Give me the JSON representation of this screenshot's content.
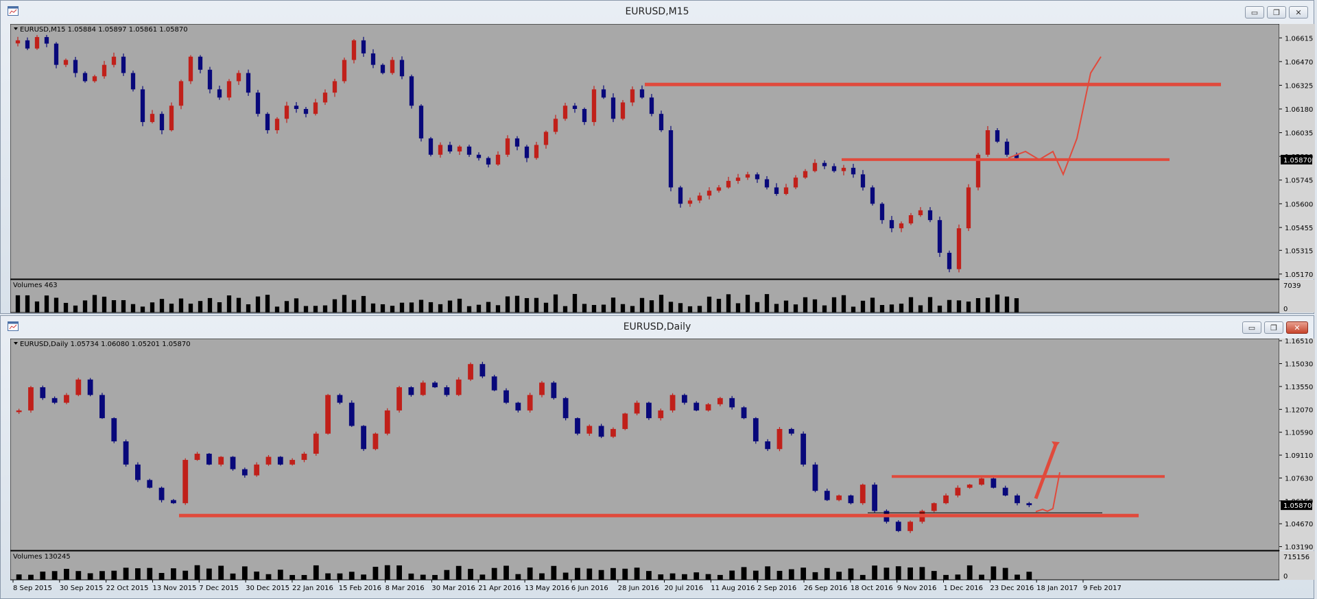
{
  "windows": [
    {
      "title": "EURUSD,M15",
      "info": "EURUSD,M15  1.05884 1.05897 1.05861 1.05870",
      "volume_label": "Volumes 463",
      "price_marker": "1.05870",
      "volume_scale": [
        "7039",
        "0"
      ],
      "buttons": [
        "minimize",
        "maximize",
        "close"
      ]
    },
    {
      "title": "EURUSD,Daily",
      "info": "EURUSD,Daily  1.05734 1.06080 1.05201 1.05870",
      "volume_label": "Volumes 130245",
      "price_marker": "1.05870",
      "volume_scale": [
        "715156",
        "0"
      ],
      "buttons": [
        "minimize",
        "maximize",
        "close"
      ]
    }
  ],
  "chart_data": [
    {
      "type": "candlestick",
      "symbol": "EURUSD",
      "timeframe": "M15",
      "y_ticks": [
        "1.06615",
        "1.06470",
        "1.06325",
        "1.06180",
        "1.06035",
        "1.05890",
        "1.05745",
        "1.05600",
        "1.05455",
        "1.05315",
        "1.05170"
      ],
      "ylim": [
        1.0514,
        1.067
      ],
      "last_price": 1.0587,
      "series": [
        {
          "name": "close",
          "values": [
            1.066,
            1.0655,
            1.0662,
            1.0658,
            1.0645,
            1.0648,
            1.064,
            1.0635,
            1.0638,
            1.0645,
            1.065,
            1.064,
            1.063,
            1.061,
            1.0615,
            1.0605,
            1.062,
            1.0635,
            1.065,
            1.0642,
            1.063,
            1.0625,
            1.0635,
            1.064,
            1.0628,
            1.0615,
            1.0605,
            1.0612,
            1.062,
            1.0618,
            1.0615,
            1.0622,
            1.0628,
            1.0635,
            1.0648,
            1.066,
            1.0652,
            1.0645,
            1.064,
            1.0648,
            1.0638,
            1.062,
            1.06,
            1.059,
            1.0596,
            1.0592,
            1.0595,
            1.059,
            1.0588,
            1.0584,
            1.059,
            1.06,
            1.0595,
            1.0588,
            1.0596,
            1.0604,
            1.0612,
            1.062,
            1.0618,
            1.061,
            1.063,
            1.0625,
            1.0612,
            1.0622,
            1.063,
            1.0625,
            1.0615,
            1.0605,
            1.057,
            1.056,
            1.0562,
            1.0565,
            1.0568,
            1.057,
            1.0574,
            1.0576,
            1.0578,
            1.0575,
            1.057,
            1.0566,
            1.057,
            1.0576,
            1.058,
            1.0585,
            1.0583,
            1.058,
            1.0582,
            1.0578,
            1.057,
            1.056,
            1.055,
            1.0545,
            1.0548,
            1.0553,
            1.0556,
            1.055,
            1.053,
            1.052,
            1.0545,
            1.057,
            1.059,
            1.0605,
            1.0598,
            1.059,
            1.0588
          ]
        }
      ],
      "annotations": [
        "horizontal line 1.0633",
        "horizontal line 1.0587",
        "projected path"
      ],
      "volume_panel": {
        "label": "Volumes 463",
        "max": 7039
      }
    },
    {
      "type": "candlestick",
      "symbol": "EURUSD",
      "timeframe": "Daily",
      "y_ticks": [
        "1.16510",
        "1.15030",
        "1.13550",
        "1.12070",
        "1.10590",
        "1.09110",
        "1.07630",
        "1.06150",
        "1.04670",
        "1.03190"
      ],
      "ylim": [
        1.0295,
        1.1665
      ],
      "last_price": 1.0587,
      "x_ticks": [
        "8 Sep 2015",
        "30 Sep 2015",
        "22 Oct 2015",
        "13 Nov 2015",
        "7 Dec 2015",
        "30 Dec 2015",
        "22 Jan 2016",
        "15 Feb 2016",
        "8 Mar 2016",
        "30 Mar 2016",
        "21 Apr 2016",
        "13 May 2016",
        "6 Jun 2016",
        "28 Jun 2016",
        "20 Jul 2016",
        "11 Aug 2016",
        "2 Sep 2016",
        "26 Sep 2016",
        "18 Oct 2016",
        "9 Nov 2016",
        "1 Dec 2016",
        "23 Dec 2016",
        "18 Jan 2017",
        "9 Feb 2017"
      ],
      "series": [
        {
          "name": "close",
          "values": [
            1.12,
            1.135,
            1.128,
            1.125,
            1.13,
            1.14,
            1.13,
            1.115,
            1.1,
            1.085,
            1.075,
            1.07,
            1.062,
            1.06,
            1.088,
            1.092,
            1.085,
            1.09,
            1.082,
            1.078,
            1.085,
            1.09,
            1.085,
            1.088,
            1.092,
            1.105,
            1.13,
            1.125,
            1.11,
            1.095,
            1.105,
            1.12,
            1.135,
            1.13,
            1.138,
            1.135,
            1.13,
            1.14,
            1.15,
            1.142,
            1.133,
            1.125,
            1.12,
            1.13,
            1.138,
            1.128,
            1.115,
            1.105,
            1.11,
            1.103,
            1.108,
            1.118,
            1.125,
            1.115,
            1.12,
            1.13,
            1.125,
            1.12,
            1.124,
            1.128,
            1.122,
            1.115,
            1.1,
            1.095,
            1.108,
            1.105,
            1.085,
            1.068,
            1.062,
            1.065,
            1.06,
            1.072,
            1.055,
            1.048,
            1.042,
            1.048,
            1.055,
            1.06,
            1.065,
            1.07,
            1.072,
            1.076,
            1.07,
            1.065,
            1.06,
            1.0587
          ]
        }
      ],
      "annotations": [
        "horizontal line 1.0773",
        "horizontal line 1.0520",
        "projected arrow up"
      ],
      "volume_panel": {
        "label": "Volumes 130245",
        "max": 715156
      }
    }
  ]
}
